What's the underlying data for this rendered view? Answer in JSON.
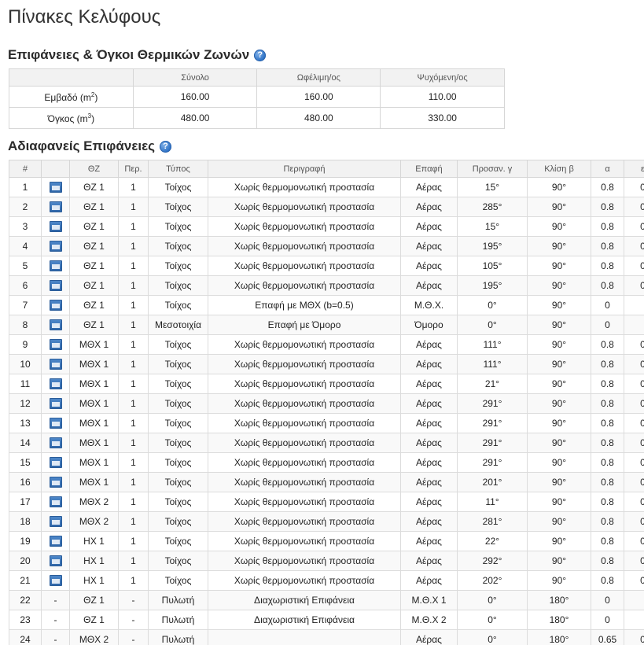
{
  "page": {
    "title": "Πίνακες Κελύφους"
  },
  "zones_section": {
    "title": "Επιφάνειες & Όγκοι Θερμικών Ζωνών",
    "help": "?",
    "columns": [
      "",
      "Σύνολο",
      "Ωφέλιμη/ος",
      "Ψυχόμενη/ος"
    ],
    "rows": [
      {
        "label_base": "Εμβαδό (m",
        "label_sup": "2",
        "label_end": ")",
        "values": [
          "160.00",
          "160.00",
          "110.00"
        ]
      },
      {
        "label_base": "Όγκος (m",
        "label_sup": "3",
        "label_end": ")",
        "values": [
          "480.00",
          "480.00",
          "330.00"
        ]
      }
    ]
  },
  "opaque_section": {
    "title": "Αδιαφανείς Επιφάνειες",
    "help": "?",
    "columns": [
      "#",
      "",
      "ΘΖ",
      "Περ.",
      "Τύπος",
      "Περιγραφή",
      "Επαφή",
      "Προσαν. γ",
      "Κλίση β",
      "α",
      "ε"
    ],
    "rows": [
      {
        "n": "1",
        "icon": "edit",
        "zone": "ΘΖ 1",
        "per": "1",
        "type": "Τοίχος",
        "desc": "Χωρίς θερμομονωτική προστασία",
        "contact": "Αέρας",
        "orient": "15°",
        "tilt": "90°",
        "a": "0.8",
        "e": "0"
      },
      {
        "n": "2",
        "icon": "edit",
        "zone": "ΘΖ 1",
        "per": "1",
        "type": "Τοίχος",
        "desc": "Χωρίς θερμομονωτική προστασία",
        "contact": "Αέρας",
        "orient": "285°",
        "tilt": "90°",
        "a": "0.8",
        "e": "0"
      },
      {
        "n": "3",
        "icon": "edit",
        "zone": "ΘΖ 1",
        "per": "1",
        "type": "Τοίχος",
        "desc": "Χωρίς θερμομονωτική προστασία",
        "contact": "Αέρας",
        "orient": "15°",
        "tilt": "90°",
        "a": "0.8",
        "e": "0"
      },
      {
        "n": "4",
        "icon": "edit",
        "zone": "ΘΖ 1",
        "per": "1",
        "type": "Τοίχος",
        "desc": "Χωρίς θερμομονωτική προστασία",
        "contact": "Αέρας",
        "orient": "195°",
        "tilt": "90°",
        "a": "0.8",
        "e": "0"
      },
      {
        "n": "5",
        "icon": "edit",
        "zone": "ΘΖ 1",
        "per": "1",
        "type": "Τοίχος",
        "desc": "Χωρίς θερμομονωτική προστασία",
        "contact": "Αέρας",
        "orient": "105°",
        "tilt": "90°",
        "a": "0.8",
        "e": "0"
      },
      {
        "n": "6",
        "icon": "edit",
        "zone": "ΘΖ 1",
        "per": "1",
        "type": "Τοίχος",
        "desc": "Χωρίς θερμομονωτική προστασία",
        "contact": "Αέρας",
        "orient": "195°",
        "tilt": "90°",
        "a": "0.8",
        "e": "0"
      },
      {
        "n": "7",
        "icon": "edit",
        "zone": "ΘΖ 1",
        "per": "1",
        "type": "Τοίχος",
        "desc": "Επαφή με ΜΘΧ (b=0.5)",
        "contact": "Μ.Θ.Χ.",
        "orient": "0°",
        "tilt": "90°",
        "a": "0",
        "e": ""
      },
      {
        "n": "8",
        "icon": "edit",
        "zone": "ΘΖ 1",
        "per": "1",
        "type": "Μεσοτοιχία",
        "desc": "Επαφή με Όμορο",
        "contact": "Όμορο",
        "orient": "0°",
        "tilt": "90°",
        "a": "0",
        "e": ""
      },
      {
        "n": "9",
        "icon": "edit",
        "zone": "ΜΘΧ 1",
        "per": "1",
        "type": "Τοίχος",
        "desc": "Χωρίς θερμομονωτική προστασία",
        "contact": "Αέρας",
        "orient": "111°",
        "tilt": "90°",
        "a": "0.8",
        "e": "0"
      },
      {
        "n": "10",
        "icon": "edit",
        "zone": "ΜΘΧ 1",
        "per": "1",
        "type": "Τοίχος",
        "desc": "Χωρίς θερμομονωτική προστασία",
        "contact": "Αέρας",
        "orient": "111°",
        "tilt": "90°",
        "a": "0.8",
        "e": "0"
      },
      {
        "n": "11",
        "icon": "edit",
        "zone": "ΜΘΧ 1",
        "per": "1",
        "type": "Τοίχος",
        "desc": "Χωρίς θερμομονωτική προστασία",
        "contact": "Αέρας",
        "orient": "21°",
        "tilt": "90°",
        "a": "0.8",
        "e": "0"
      },
      {
        "n": "12",
        "icon": "edit",
        "zone": "ΜΘΧ 1",
        "per": "1",
        "type": "Τοίχος",
        "desc": "Χωρίς θερμομονωτική προστασία",
        "contact": "Αέρας",
        "orient": "291°",
        "tilt": "90°",
        "a": "0.8",
        "e": "0"
      },
      {
        "n": "13",
        "icon": "edit",
        "zone": "ΜΘΧ 1",
        "per": "1",
        "type": "Τοίχος",
        "desc": "Χωρίς θερμομονωτική προστασία",
        "contact": "Αέρας",
        "orient": "291°",
        "tilt": "90°",
        "a": "0.8",
        "e": "0"
      },
      {
        "n": "14",
        "icon": "edit",
        "zone": "ΜΘΧ 1",
        "per": "1",
        "type": "Τοίχος",
        "desc": "Χωρίς θερμομονωτική προστασία",
        "contact": "Αέρας",
        "orient": "291°",
        "tilt": "90°",
        "a": "0.8",
        "e": "0"
      },
      {
        "n": "15",
        "icon": "edit",
        "zone": "ΜΘΧ 1",
        "per": "1",
        "type": "Τοίχος",
        "desc": "Χωρίς θερμομονωτική προστασία",
        "contact": "Αέρας",
        "orient": "291°",
        "tilt": "90°",
        "a": "0.8",
        "e": "0"
      },
      {
        "n": "16",
        "icon": "edit",
        "zone": "ΜΘΧ 1",
        "per": "1",
        "type": "Τοίχος",
        "desc": "Χωρίς θερμομονωτική προστασία",
        "contact": "Αέρας",
        "orient": "201°",
        "tilt": "90°",
        "a": "0.8",
        "e": "0"
      },
      {
        "n": "17",
        "icon": "edit",
        "zone": "ΜΘΧ 2",
        "per": "1",
        "type": "Τοίχος",
        "desc": "Χωρίς θερμομονωτική προστασία",
        "contact": "Αέρας",
        "orient": "11°",
        "tilt": "90°",
        "a": "0.8",
        "e": "0"
      },
      {
        "n": "18",
        "icon": "edit",
        "zone": "ΜΘΧ 2",
        "per": "1",
        "type": "Τοίχος",
        "desc": "Χωρίς θερμομονωτική προστασία",
        "contact": "Αέρας",
        "orient": "281°",
        "tilt": "90°",
        "a": "0.8",
        "e": "0"
      },
      {
        "n": "19",
        "icon": "edit",
        "zone": "ΗΧ 1",
        "per": "1",
        "type": "Τοίχος",
        "desc": "Χωρίς θερμομονωτική προστασία",
        "contact": "Αέρας",
        "orient": "22°",
        "tilt": "90°",
        "a": "0.8",
        "e": "0"
      },
      {
        "n": "20",
        "icon": "edit",
        "zone": "ΗΧ 1",
        "per": "1",
        "type": "Τοίχος",
        "desc": "Χωρίς θερμομονωτική προστασία",
        "contact": "Αέρας",
        "orient": "292°",
        "tilt": "90°",
        "a": "0.8",
        "e": "0"
      },
      {
        "n": "21",
        "icon": "edit",
        "zone": "ΗΧ 1",
        "per": "1",
        "type": "Τοίχος",
        "desc": "Χωρίς θερμομονωτική προστασία",
        "contact": "Αέρας",
        "orient": "202°",
        "tilt": "90°",
        "a": "0.8",
        "e": "0"
      },
      {
        "n": "22",
        "icon": "-",
        "zone": "ΘΖ 1",
        "per": "-",
        "type": "Πυλωτή",
        "desc": "Διαχωριστική Επιφάνεια",
        "contact": "Μ.Θ.Χ 1",
        "orient": "0°",
        "tilt": "180°",
        "a": "0",
        "e": ""
      },
      {
        "n": "23",
        "icon": "-",
        "zone": "ΘΖ 1",
        "per": "-",
        "type": "Πυλωτή",
        "desc": "Διαχωριστική Επιφάνεια",
        "contact": "Μ.Θ.Χ 2",
        "orient": "0°",
        "tilt": "180°",
        "a": "0",
        "e": ""
      },
      {
        "n": "24",
        "icon": "-",
        "zone": "ΜΘΧ 2",
        "per": "-",
        "type": "Πυλωτή",
        "desc": "",
        "contact": "Αέρας",
        "orient": "0°",
        "tilt": "180°",
        "a": "0.65",
        "e": "0"
      }
    ]
  }
}
